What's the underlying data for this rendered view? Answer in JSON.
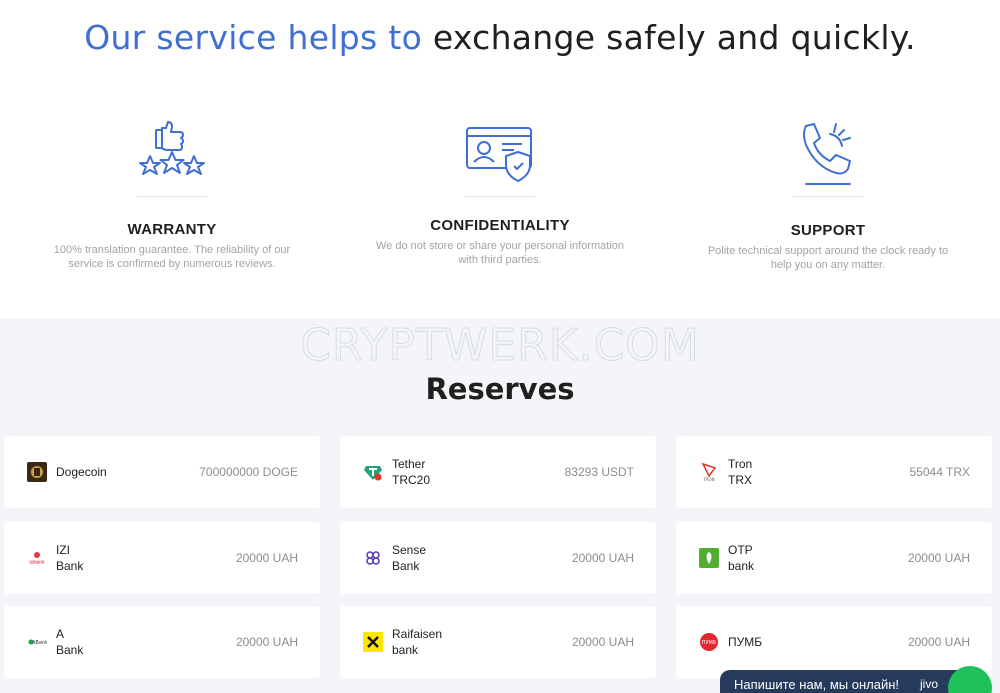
{
  "hero": {
    "accent": "Our service helps to",
    "rest": "exchange safely and quickly."
  },
  "features": [
    {
      "title": "WARRANTY",
      "desc": "100% translation guarantee. The reliability of our service is confirmed by numerous reviews.",
      "icon": "thumbs-up-stars-icon"
    },
    {
      "title": "CONFIDENTIALITY",
      "desc": "We do not store or share your personal information with third parties.",
      "icon": "id-card-shield-icon"
    },
    {
      "title": "SUPPORT",
      "desc": "Polite technical support around the clock ready to help you on any matter.",
      "icon": "phone-ringing-icon"
    }
  ],
  "watermark": "CRYPTWERK.COM",
  "reserves": {
    "title": "Reserves",
    "items": [
      {
        "name": "Dogecoin",
        "amount": "700000000 DOGE",
        "icon": "dogecoin-logo"
      },
      {
        "name": "Tether\nTRC20",
        "amount": "83293 USDT",
        "icon": "tether-logo"
      },
      {
        "name": "Tron\nTRX",
        "amount": "55044 TRX",
        "icon": "tron-logo"
      },
      {
        "name": "IZI\nBank",
        "amount": "20000 UAH",
        "icon": "izibank-logo"
      },
      {
        "name": "Sense\nBank",
        "amount": "20000 UAH",
        "icon": "sensebank-logo"
      },
      {
        "name": "OTP\nbank",
        "amount": "20000 UAH",
        "icon": "otpbank-logo"
      },
      {
        "name": "A\nBank",
        "amount": "20000 UAH",
        "icon": "abank-logo"
      },
      {
        "name": "Raifaisen\nbank",
        "amount": "20000 UAH",
        "icon": "raiffeisen-logo"
      },
      {
        "name": "ПУМБ",
        "amount": "20000 UAH",
        "icon": "pumb-logo"
      }
    ]
  },
  "chat": {
    "label": "Напишите нам, мы онлайн!",
    "brand": "jivo"
  },
  "colors": {
    "accent": "#3f6fd0",
    "section_bg": "#f3f5f8",
    "chat_bg": "#263a5c",
    "chat_online": "#1fc25a"
  }
}
